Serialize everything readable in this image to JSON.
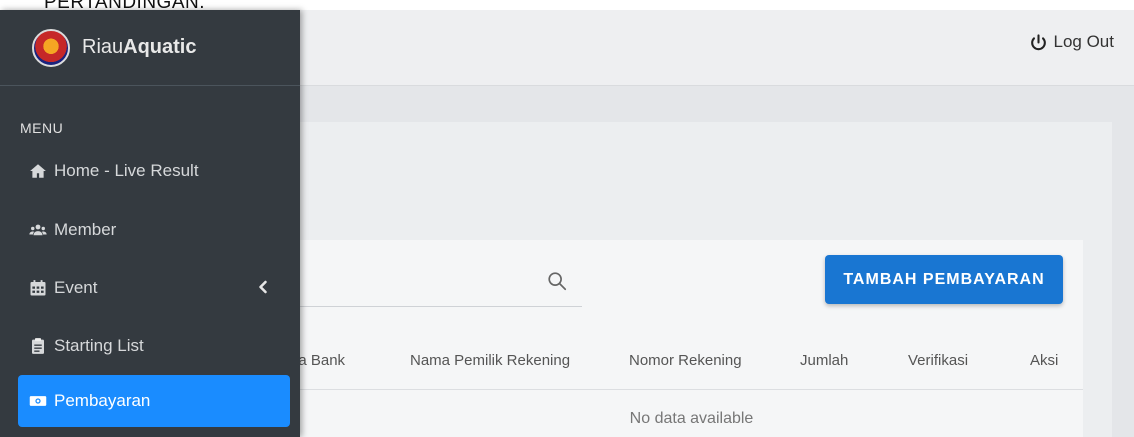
{
  "top_cut_text": "PERTANDINGAN.",
  "header": {
    "logout_label": "Log Out"
  },
  "brand": {
    "prefix": "Riau",
    "bold": "Aquatic",
    "logo_icon": "riau-aquatic-logo"
  },
  "sidebar": {
    "menu_header": "MENU",
    "items": [
      {
        "label": "Home - Live Result",
        "icon": "home-icon"
      },
      {
        "label": "Member",
        "icon": "users-icon"
      },
      {
        "label": "Event",
        "icon": "calendar-icon",
        "has_chevron": true
      },
      {
        "label": "Starting List",
        "icon": "clipboard-icon"
      },
      {
        "label": "Pembayaran",
        "icon": "money-bill-icon",
        "active": true
      }
    ]
  },
  "search": {
    "placeholder": ""
  },
  "add_button_label": "TAMBAH PEMBAYARAN",
  "table": {
    "headers": [
      "na Bank",
      "Nama Pemilik Rekening",
      "Nomor Rekening",
      "Jumlah",
      "Verifikasi",
      "Aksi"
    ],
    "empty_text": "No data available"
  },
  "colors": {
    "sidebar_bg": "#343a40",
    "active_item": "#1a8cff",
    "primary_button": "#1976d2"
  }
}
